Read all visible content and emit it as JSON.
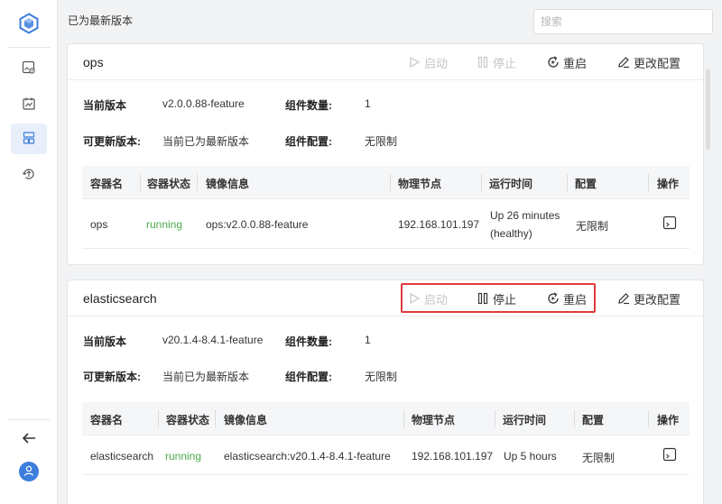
{
  "top": {
    "status_message": "已为最新版本",
    "search_placeholder": "搜索"
  },
  "sidebar": {
    "items": [
      {
        "name": "settings-image-icon"
      },
      {
        "name": "calendar-chart-icon"
      },
      {
        "name": "server-stack-icon",
        "active": true
      },
      {
        "name": "upgrade-icon"
      }
    ],
    "collapse_icon": "arrow-left-icon",
    "avatar_icon": "user-icon"
  },
  "actions": {
    "start": "启动",
    "stop": "停止",
    "restart": "重启",
    "edit_config": "更改配置"
  },
  "labels": {
    "current_version": "当前版本",
    "component_count": "组件数量:",
    "updatable_version": "可更新版本:",
    "component_config": "组件配置:"
  },
  "table_headers": [
    "容器名",
    "容器状态",
    "镜像信息",
    "物理节点",
    "运行时间",
    "配置",
    "操作"
  ],
  "components": [
    {
      "name": "ops",
      "current_version": "v2.0.0.88-feature",
      "component_count": "1",
      "updatable_version": "当前已为最新版本",
      "component_config": "无限制",
      "rows": [
        {
          "container": "ops",
          "status": "running",
          "image": "ops:v2.0.0.88-feature",
          "node": "192.168.101.197",
          "uptime_line1": "Up 26 minutes",
          "uptime_line2": "(healthy)",
          "config": "无限制"
        }
      ]
    },
    {
      "name": "elasticsearch",
      "current_version": "v20.1.4-8.4.1-feature",
      "component_count": "1",
      "updatable_version": "当前已为最新版本",
      "component_config": "无限制",
      "rows": [
        {
          "container": "elasticsearch",
          "status": "running",
          "image": "elasticsearch:v20.1.4-8.4.1-feature",
          "node": "192.168.101.197",
          "uptime_line1": "Up 5 hours",
          "config": "无限制"
        }
      ]
    }
  ],
  "colors": {
    "accent": "#3d7ddd",
    "running": "#4caa4c",
    "highlight": "#e03b3b",
    "disabled": "#c5c5c5"
  }
}
